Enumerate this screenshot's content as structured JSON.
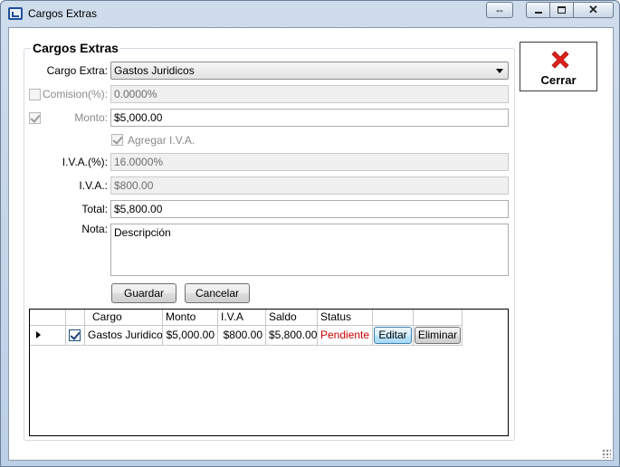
{
  "window": {
    "title": "Cargos Extras"
  },
  "group": {
    "title": "Cargos Extras"
  },
  "form": {
    "cargo_extra_label": "Cargo Extra:",
    "cargo_extra_value": "Gastos Juridicos",
    "comision_label": "Comision(%):",
    "comision_value": "0.0000%",
    "monto_label": "Monto:",
    "monto_value": "$5,000.00",
    "agregar_iva_label": "Agregar I.V.A.",
    "iva_pct_label": "I.V.A.(%):",
    "iva_pct_value": "16.0000%",
    "iva_label": "I.V.A.:",
    "iva_value": "$800.00",
    "total_label": "Total:",
    "total_value": "$5,800.00",
    "nota_label": "Nota:",
    "nota_value": "Descripción",
    "guardar_label": "Guardar",
    "cancelar_label": "Cancelar"
  },
  "cerrar": {
    "label": "Cerrar"
  },
  "grid": {
    "columns": [
      "Cargo",
      "Monto",
      "I.V.A",
      "Saldo",
      "Status"
    ],
    "rows": [
      {
        "cargo": "Gastos Juridicos",
        "monto": "$5,000.00",
        "iva": "$800.00",
        "saldo": "$5,800.00",
        "status": "Pendiente",
        "editar": "Editar",
        "eliminar": "Eliminar"
      }
    ]
  },
  "colors": {
    "status_pending": "#cc0000",
    "accent": "#1f4f9a"
  }
}
